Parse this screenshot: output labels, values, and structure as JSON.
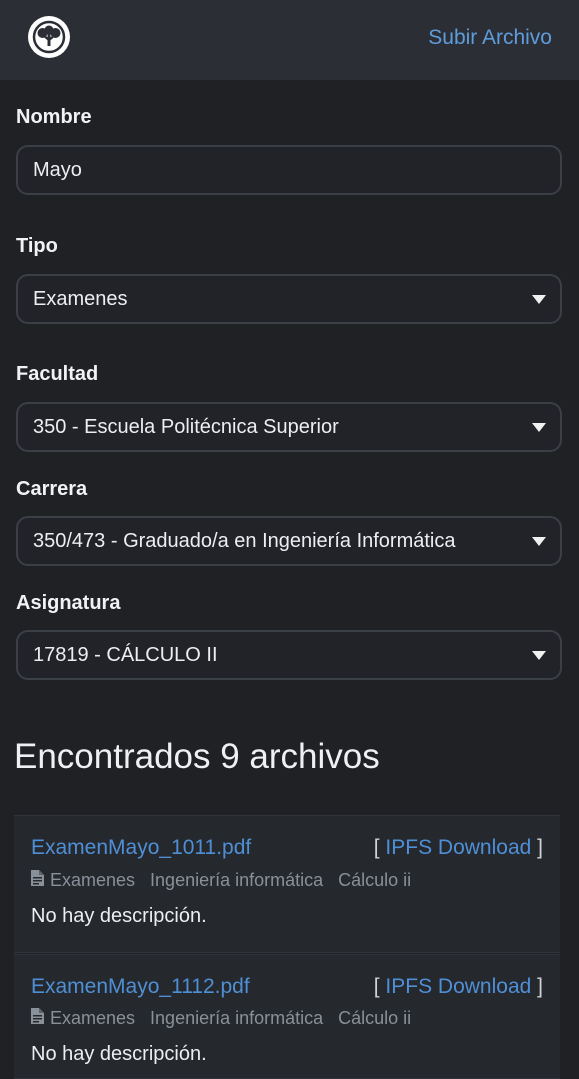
{
  "navbar": {
    "logo_icon": "tree-logo-icon",
    "upload_link": "Subir Archivo"
  },
  "form": {
    "nombre": {
      "label": "Nombre",
      "value": "Mayo"
    },
    "tipo": {
      "label": "Tipo",
      "value": "Examenes"
    },
    "facultad": {
      "label": "Facultad",
      "value": "350 - Escuela Politécnica Superior"
    },
    "carrera": {
      "label": "Carrera",
      "value": "350/473 - Graduado/a en Ingeniería Informática"
    },
    "asignatura": {
      "label": "Asignatura",
      "value": "17819 - CÁLCULO II"
    }
  },
  "results": {
    "heading": "Encontrados 9 archivos",
    "files": [
      {
        "name": "ExamenMayo_1011.pdf",
        "download_label": "IPFS Download",
        "tags": [
          "Examenes",
          "Ingeniería informática",
          "Cálculo ii"
        ],
        "description": "No hay descripción."
      },
      {
        "name": "ExamenMayo_1112.pdf",
        "download_label": "IPFS Download",
        "tags": [
          "Examenes",
          "Ingeniería informática",
          "Cálculo ii"
        ],
        "description": "No hay descripción."
      }
    ]
  },
  "colors": {
    "background": "#1f2125",
    "navbar": "#2b2f35",
    "link": "#4f8fd6"
  }
}
